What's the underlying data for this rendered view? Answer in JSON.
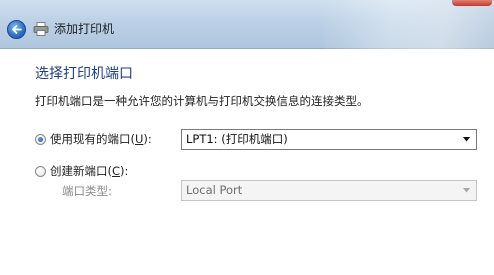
{
  "window": {
    "title": "添加打印机"
  },
  "page": {
    "title": "选择打印机端口",
    "description": "打印机端口是一种允许您的计算机与打印机交换信息的连接类型。"
  },
  "options": {
    "existing": {
      "label_prefix": "使用现有的端口(",
      "hotkey": "U",
      "label_suffix": "):",
      "checked": true
    },
    "create": {
      "label_prefix": "创建新端口(",
      "hotkey": "C",
      "label_suffix": "):",
      "checked": false
    }
  },
  "existing_port_select": {
    "value": "LPT1: (打印机端口)"
  },
  "port_type": {
    "label": "端口类型:",
    "value": "Local Port",
    "disabled": true
  },
  "icons": {
    "back": "back-arrow-icon",
    "printer": "printer-icon",
    "dropdown": "chevron-down-icon"
  }
}
